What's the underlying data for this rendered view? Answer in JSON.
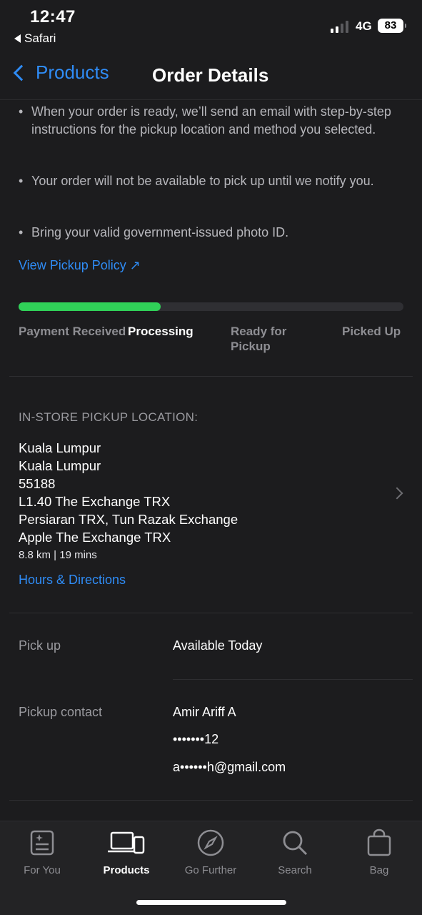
{
  "status_bar": {
    "time": "12:47",
    "back_app": "Safari",
    "network": "4G",
    "battery": "83"
  },
  "nav": {
    "back_label": "Products",
    "title": "Order Details"
  },
  "instructions": [
    "When your order is ready, we’ll send an email with step-by-step instructions for the pickup location and method you selected.",
    "Your order will not be available to pick up until we notify you.",
    "Bring your valid government-issued photo ID."
  ],
  "pickup_policy_link": "View Pickup Policy ↗",
  "progress": {
    "fraction_complete": 0.37,
    "steps": [
      {
        "label": "Payment Received",
        "active": false
      },
      {
        "label": "Processing",
        "active": true
      },
      {
        "label": "Ready for Pickup",
        "active": false
      },
      {
        "label": "Picked Up",
        "active": false
      }
    ]
  },
  "pickup_location": {
    "section_title": "IN-STORE PICKUP LOCATION:",
    "lines": [
      "Kuala Lumpur",
      "Kuala Lumpur",
      "55188",
      "L1.40 The Exchange TRX",
      "Persiaran TRX, Tun Razak Exchange",
      "Apple The Exchange TRX"
    ],
    "distance": "8.8 km | 19 mins",
    "directions_link": "Hours & Directions"
  },
  "pickup": {
    "label": "Pick up",
    "value": "Available Today"
  },
  "contact": {
    "label": "Pickup contact",
    "name": "Amir Ariff A",
    "phone": "•••••••12",
    "email": "a••••••h@gmail.com"
  },
  "tabs": [
    {
      "label": "For You",
      "icon": "for-you-icon",
      "active": false
    },
    {
      "label": "Products",
      "icon": "products-icon",
      "active": true
    },
    {
      "label": "Go Further",
      "icon": "compass-icon",
      "active": false
    },
    {
      "label": "Search",
      "icon": "search-icon",
      "active": false
    },
    {
      "label": "Bag",
      "icon": "bag-icon",
      "active": false
    }
  ],
  "colors": {
    "accent": "#2f8cf6",
    "progress": "#30d158",
    "background": "#1c1c1e"
  }
}
